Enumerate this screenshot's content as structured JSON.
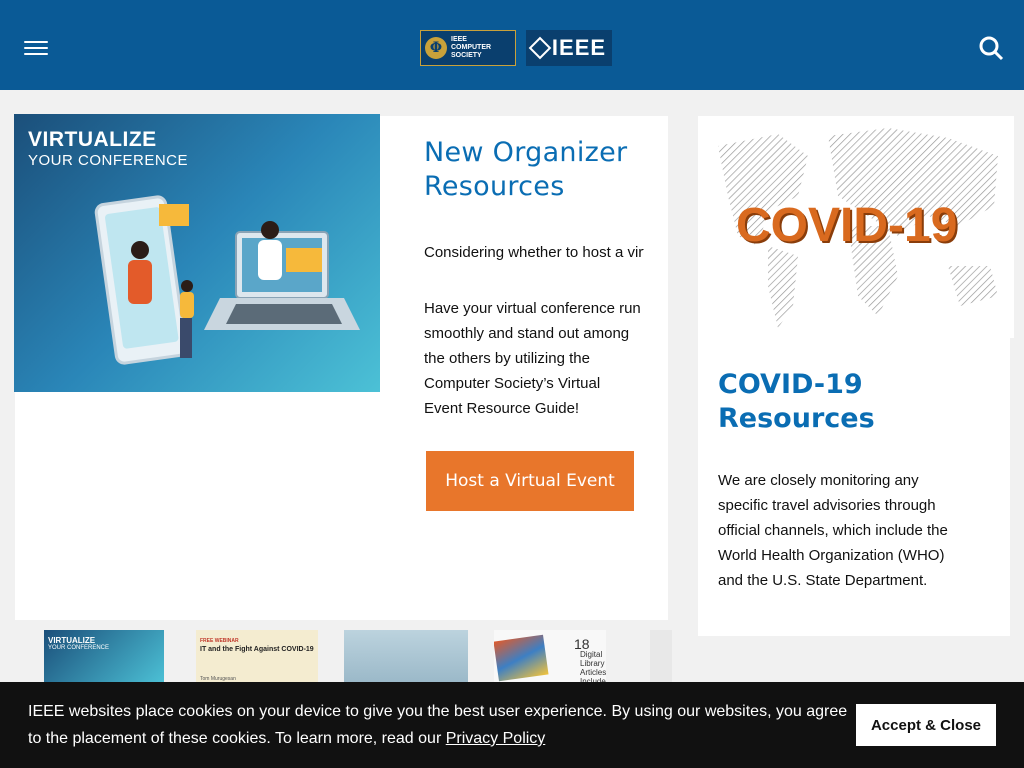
{
  "header": {
    "menu_icon": "hamburger-icon",
    "cs_logo_lines": [
      "IEEE",
      "COMPUTER",
      "SOCIETY"
    ],
    "cs_logo_symbol": "Φ",
    "ieee_logo": "IEEE",
    "search_icon": "search-icon",
    "brand_color": "#0a5a96"
  },
  "feature": {
    "image_line1": "VIRTUALIZE",
    "image_line2": "YOUR CONFERENCE",
    "title": "New Organizer Resources",
    "text_short": "Considering whether to host a virtual event?",
    "text_body": "Have your virtual conference run smoothly and stand out among the others by utilizing the Computer Society’s Virtual Event Resource Guide!",
    "button_label": "Host a Virtual Event",
    "accent_color": "#e8762b"
  },
  "covid": {
    "image_word": "COVID-19",
    "title": "COVID-19 Resources",
    "text": "We are closely monitoring any specific travel advisories through official channels, which include the World Health Organization (WHO) and the U.S. State Department."
  },
  "thumbnails": {
    "t1_line1": "VIRTUALIZE",
    "t1_line2": "YOUR CONFERENCE",
    "t2_tag": "FREE WEBINAR",
    "t2_title": "IT and the Fight Against COVID-19",
    "t2_footer": "Tom Murugesan",
    "t4_number": "18",
    "t4_text": "Digital Library Articles Included"
  },
  "cookie_banner": {
    "text_before": "IEEE websites place cookies on your device to give you the best user experience. By using our websites, you agree to the placement of these cookies. To learn more, read our ",
    "link_label": "Privacy Policy",
    "accept_label": "Accept & Close"
  }
}
